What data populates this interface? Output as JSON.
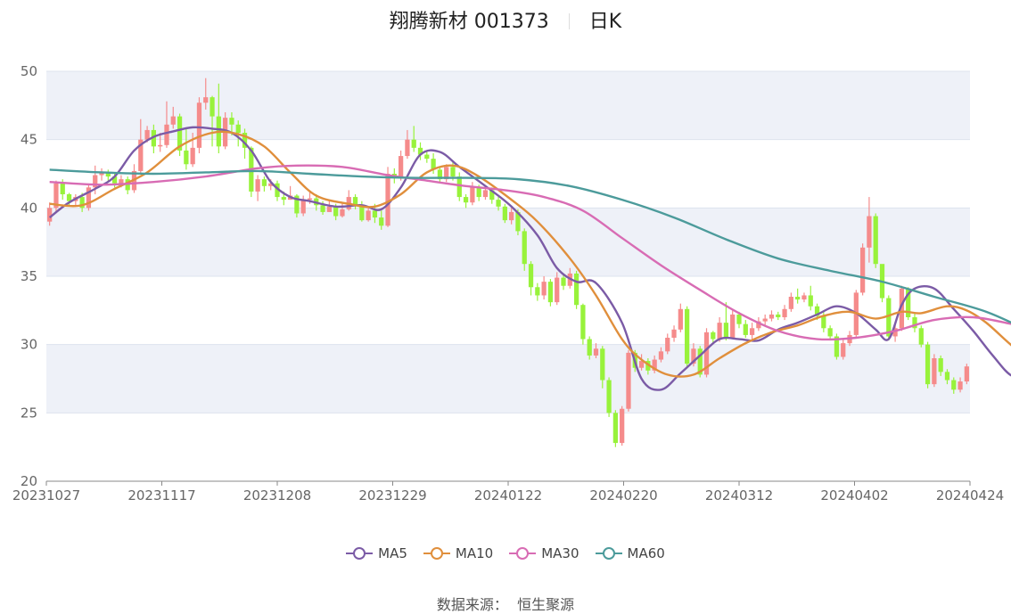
{
  "title": {
    "name": "翔腾新材 001373",
    "period": "日K"
  },
  "source": {
    "label": "数据来源：",
    "value": "恒生聚源"
  },
  "colors": {
    "up": "#f58b8b",
    "down": "#98f23b",
    "ma5": "#7b5ba6",
    "ma10": "#e08f3c",
    "ma30": "#d86cb4",
    "ma60": "#4c9b9b",
    "band": "#eef1f8",
    "grid": "#dde3ee"
  },
  "chart_data": {
    "type": "candlestick",
    "ylim": [
      20,
      50
    ],
    "yticks": [
      "20",
      "25",
      "30",
      "35",
      "40",
      "45",
      "50"
    ],
    "xticks": [
      "20231027",
      "20231117",
      "20231208",
      "20231229",
      "20240122",
      "20240220",
      "20240312",
      "20240402",
      "20240424"
    ],
    "candles": [
      [
        39.0,
        40.0,
        38.7,
        40.4
      ],
      [
        40.0,
        41.8,
        39.6,
        42.0
      ],
      [
        41.8,
        41.0,
        40.6,
        42.1
      ],
      [
        41.0,
        40.5,
        40.2,
        41.1
      ],
      [
        40.5,
        40.8,
        40.2,
        41.0
      ],
      [
        40.8,
        40.0,
        39.7,
        41.1
      ],
      [
        40.0,
        41.5,
        39.8,
        41.7
      ],
      [
        41.5,
        42.4,
        41.0,
        43.1
      ],
      [
        42.4,
        42.6,
        42.0,
        42.9
      ],
      [
        42.6,
        42.3,
        42.0,
        42.8
      ],
      [
        42.3,
        41.8,
        41.5,
        42.6
      ],
      [
        41.8,
        42.1,
        41.5,
        42.4
      ],
      [
        42.1,
        41.3,
        41.0,
        42.3
      ],
      [
        41.3,
        42.7,
        41.1,
        43.2
      ],
      [
        42.7,
        45.0,
        42.5,
        46.5
      ],
      [
        45.0,
        45.7,
        44.8,
        46.0
      ],
      [
        45.7,
        44.5,
        44.0,
        46.1
      ],
      [
        44.5,
        44.6,
        44.1,
        45.5
      ],
      [
        44.6,
        46.1,
        44.4,
        47.8
      ],
      [
        46.1,
        46.7,
        45.8,
        47.4
      ],
      [
        46.7,
        44.2,
        43.8,
        46.9
      ],
      [
        44.2,
        43.2,
        42.8,
        45.8
      ],
      [
        43.2,
        44.4,
        43.0,
        45.5
      ],
      [
        44.4,
        47.7,
        44.0,
        48.1
      ],
      [
        47.7,
        48.1,
        47.2,
        49.5
      ],
      [
        48.1,
        46.7,
        44.5,
        48.2
      ],
      [
        46.7,
        44.5,
        44.0,
        49.1
      ],
      [
        44.5,
        46.6,
        44.3,
        47.0
      ],
      [
        46.6,
        46.1,
        45.3,
        47.0
      ],
      [
        46.1,
        45.5,
        44.5,
        46.4
      ],
      [
        45.5,
        44.4,
        43.6,
        45.8
      ],
      [
        44.4,
        41.2,
        40.8,
        44.5
      ],
      [
        41.2,
        42.1,
        40.5,
        42.4
      ],
      [
        42.1,
        41.6,
        41.2,
        42.3
      ],
      [
        41.6,
        41.8,
        41.3,
        42.1
      ],
      [
        41.8,
        40.8,
        40.5,
        42.0
      ],
      [
        40.8,
        40.6,
        40.2,
        41.2
      ],
      [
        40.6,
        40.9,
        40.6,
        41.6
      ],
      [
        40.9,
        39.6,
        39.3,
        41.0
      ],
      [
        39.6,
        40.6,
        39.4,
        40.9
      ],
      [
        40.6,
        40.7,
        40.3,
        41.2
      ],
      [
        40.7,
        40.2,
        39.8,
        41.0
      ],
      [
        40.2,
        39.7,
        39.5,
        40.5
      ],
      [
        39.7,
        40.1,
        39.7,
        40.6
      ],
      [
        40.1,
        39.4,
        39.1,
        40.3
      ],
      [
        39.4,
        39.9,
        39.3,
        40.4
      ],
      [
        39.9,
        40.8,
        39.8,
        41.3
      ],
      [
        40.8,
        40.2,
        39.9,
        41.0
      ],
      [
        40.2,
        39.1,
        39.0,
        40.5
      ],
      [
        39.1,
        39.8,
        39.0,
        40.1
      ],
      [
        39.8,
        39.3,
        38.9,
        40.3
      ],
      [
        39.3,
        38.7,
        38.4,
        39.8
      ],
      [
        38.7,
        42.5,
        38.6,
        43.0
      ],
      [
        42.5,
        42.3,
        41.8,
        42.9
      ],
      [
        42.3,
        43.8,
        42.0,
        44.2
      ],
      [
        43.8,
        45.0,
        43.6,
        45.7
      ],
      [
        45.0,
        44.4,
        44.1,
        46.0
      ],
      [
        44.4,
        43.9,
        43.5,
        44.8
      ],
      [
        43.9,
        43.6,
        43.3,
        44.2
      ],
      [
        43.6,
        42.8,
        42.5,
        44.0
      ],
      [
        42.8,
        42.1,
        41.8,
        43.0
      ],
      [
        42.1,
        43.0,
        41.9,
        43.2
      ],
      [
        43.0,
        42.3,
        42.0,
        43.4
      ],
      [
        42.3,
        40.8,
        40.5,
        42.6
      ],
      [
        40.8,
        40.4,
        40.0,
        41.0
      ],
      [
        40.4,
        41.5,
        40.2,
        41.9
      ],
      [
        41.5,
        40.8,
        40.5,
        41.7
      ],
      [
        40.8,
        41.3,
        40.6,
        41.6
      ],
      [
        41.3,
        40.6,
        40.3,
        41.5
      ],
      [
        40.6,
        40.1,
        39.8,
        40.8
      ],
      [
        40.1,
        39.1,
        38.9,
        40.3
      ],
      [
        39.1,
        39.7,
        38.8,
        40.0
      ],
      [
        39.7,
        38.3,
        38.0,
        39.9
      ],
      [
        38.3,
        35.9,
        35.4,
        38.5
      ],
      [
        35.9,
        34.2,
        33.6,
        36.1
      ],
      [
        34.2,
        33.6,
        33.2,
        34.5
      ],
      [
        33.6,
        34.6,
        33.3,
        35.0
      ],
      [
        34.6,
        33.1,
        32.8,
        34.8
      ],
      [
        33.1,
        34.9,
        32.9,
        35.3
      ],
      [
        34.9,
        34.3,
        34.0,
        35.2
      ],
      [
        34.3,
        35.2,
        34.1,
        35.6
      ],
      [
        35.2,
        32.9,
        32.6,
        35.4
      ],
      [
        32.9,
        30.4,
        30.0,
        33.0
      ],
      [
        30.4,
        29.2,
        28.9,
        30.6
      ],
      [
        29.2,
        29.7,
        29.0,
        30.1
      ],
      [
        29.7,
        27.4,
        26.8,
        29.9
      ],
      [
        27.4,
        25.0,
        24.7,
        27.6
      ],
      [
        25.0,
        22.8,
        22.5,
        25.2
      ],
      [
        22.8,
        25.3,
        22.6,
        25.5
      ],
      [
        25.3,
        29.4,
        25.1,
        29.6
      ],
      [
        29.4,
        28.3,
        28.0,
        29.6
      ],
      [
        28.3,
        28.8,
        28.1,
        29.3
      ],
      [
        28.8,
        28.1,
        27.8,
        29.0
      ],
      [
        28.1,
        28.9,
        27.9,
        29.2
      ],
      [
        28.9,
        29.5,
        28.7,
        29.8
      ],
      [
        29.5,
        30.5,
        29.3,
        30.8
      ],
      [
        30.5,
        31.1,
        30.2,
        31.4
      ],
      [
        31.1,
        32.6,
        30.9,
        33.0
      ],
      [
        32.6,
        28.6,
        28.3,
        32.8
      ],
      [
        28.6,
        29.7,
        28.4,
        30.1
      ],
      [
        29.7,
        27.8,
        27.6,
        29.9
      ],
      [
        27.8,
        30.9,
        27.6,
        31.2
      ],
      [
        30.9,
        30.4,
        30.1,
        31.0
      ],
      [
        30.4,
        31.6,
        30.2,
        32.0
      ],
      [
        31.6,
        30.5,
        30.3,
        33.1
      ],
      [
        30.5,
        32.2,
        30.4,
        32.5
      ],
      [
        32.2,
        31.5,
        31.2,
        32.4
      ],
      [
        31.5,
        30.7,
        30.5,
        31.8
      ],
      [
        30.7,
        31.2,
        30.4,
        31.6
      ],
      [
        31.2,
        31.7,
        31.0,
        32.0
      ],
      [
        31.7,
        31.9,
        31.4,
        32.2
      ],
      [
        31.9,
        32.2,
        31.7,
        32.5
      ],
      [
        32.2,
        32.0,
        31.8,
        32.4
      ],
      [
        32.0,
        32.6,
        31.8,
        32.9
      ],
      [
        32.6,
        33.5,
        32.4,
        33.8
      ],
      [
        33.5,
        33.3,
        33.0,
        34.1
      ],
      [
        33.3,
        33.6,
        33.1,
        33.8
      ],
      [
        33.6,
        32.8,
        32.5,
        34.3
      ],
      [
        32.8,
        32.1,
        31.8,
        33.0
      ],
      [
        32.1,
        31.2,
        30.9,
        32.4
      ],
      [
        31.2,
        30.6,
        30.3,
        31.4
      ],
      [
        30.6,
        29.1,
        28.9,
        30.8
      ],
      [
        29.1,
        30.1,
        28.9,
        30.4
      ],
      [
        30.1,
        30.7,
        29.9,
        31.0
      ],
      [
        30.7,
        33.8,
        30.5,
        34.0
      ],
      [
        33.8,
        37.1,
        33.6,
        37.4
      ],
      [
        37.1,
        39.4,
        36.0,
        40.8
      ],
      [
        39.4,
        35.9,
        35.6,
        39.6
      ],
      [
        35.9,
        33.4,
        33.1,
        35.3
      ],
      [
        33.4,
        30.6,
        30.3,
        33.6
      ],
      [
        30.6,
        31.2,
        30.2,
        31.5
      ],
      [
        31.2,
        34.1,
        31.0,
        34.3
      ],
      [
        34.1,
        32.0,
        31.8,
        34.2
      ],
      [
        32.0,
        31.2,
        30.9,
        32.3
      ],
      [
        31.2,
        30.0,
        29.8,
        31.4
      ],
      [
        30.0,
        27.1,
        26.8,
        30.2
      ],
      [
        27.1,
        29.0,
        26.9,
        29.3
      ],
      [
        29.0,
        28.0,
        27.7,
        29.2
      ],
      [
        28.0,
        27.4,
        27.1,
        28.2
      ],
      [
        27.4,
        26.7,
        26.4,
        27.6
      ],
      [
        26.7,
        27.3,
        26.5,
        27.6
      ],
      [
        27.3,
        28.4,
        27.1,
        28.6
      ]
    ],
    "series": [
      {
        "name": "MA5",
        "points": [
          [
            0,
            39.3
          ],
          [
            3,
            40.4
          ],
          [
            7,
            41.4
          ],
          [
            10,
            42.3
          ],
          [
            13,
            44.2
          ],
          [
            16,
            45.2
          ],
          [
            19,
            45.6
          ],
          [
            22,
            45.9
          ],
          [
            25,
            45.8
          ],
          [
            28,
            45.5
          ],
          [
            31,
            44.2
          ],
          [
            34,
            41.9
          ],
          [
            37,
            40.8
          ],
          [
            40,
            40.5
          ],
          [
            44,
            40.1
          ],
          [
            48,
            40.2
          ],
          [
            51,
            39.9
          ],
          [
            54,
            41.5
          ],
          [
            57,
            43.9
          ],
          [
            60,
            44.1
          ],
          [
            63,
            43.0
          ],
          [
            67,
            41.6
          ],
          [
            71,
            40.1
          ],
          [
            75,
            38.0
          ],
          [
            78,
            35.6
          ],
          [
            81,
            34.6
          ],
          [
            84,
            34.5
          ],
          [
            88,
            31.6
          ],
          [
            91,
            27.5
          ],
          [
            94,
            26.7
          ],
          [
            97,
            27.9
          ],
          [
            100,
            29.2
          ],
          [
            103,
            30.4
          ],
          [
            106,
            30.4
          ],
          [
            109,
            30.3
          ],
          [
            112,
            31.1
          ],
          [
            115,
            31.6
          ],
          [
            118,
            32.2
          ],
          [
            121,
            32.8
          ],
          [
            124,
            32.3
          ],
          [
            127,
            31.1
          ],
          [
            129,
            30.4
          ],
          [
            131,
            32.9
          ],
          [
            133,
            34.1
          ],
          [
            136,
            34.1
          ],
          [
            139,
            32.6
          ],
          [
            142,
            31.0
          ],
          [
            145,
            29.2
          ],
          [
            148,
            27.7
          ],
          [
            151,
            27.8
          ]
        ]
      },
      {
        "name": "MA10",
        "points": [
          [
            0,
            40.3
          ],
          [
            5,
            40.2
          ],
          [
            10,
            41.4
          ],
          [
            15,
            42.6
          ],
          [
            20,
            44.5
          ],
          [
            25,
            45.5
          ],
          [
            29,
            45.4
          ],
          [
            33,
            44.5
          ],
          [
            37,
            42.6
          ],
          [
            41,
            40.9
          ],
          [
            46,
            40.3
          ],
          [
            50,
            40.1
          ],
          [
            54,
            41.0
          ],
          [
            58,
            42.6
          ],
          [
            62,
            43.1
          ],
          [
            66,
            42.3
          ],
          [
            71,
            40.6
          ],
          [
            75,
            39.0
          ],
          [
            80,
            36.3
          ],
          [
            84,
            33.6
          ],
          [
            88,
            30.4
          ],
          [
            91,
            28.9
          ],
          [
            95,
            27.8
          ],
          [
            99,
            27.8
          ],
          [
            103,
            29.0
          ],
          [
            107,
            30.1
          ],
          [
            111,
            30.9
          ],
          [
            115,
            31.4
          ],
          [
            119,
            32.1
          ],
          [
            123,
            32.4
          ],
          [
            127,
            31.9
          ],
          [
            131,
            32.4
          ],
          [
            134,
            32.3
          ],
          [
            138,
            32.8
          ],
          [
            141,
            32.5
          ],
          [
            144,
            31.6
          ],
          [
            148,
            29.9
          ],
          [
            151,
            28.9
          ]
        ]
      },
      {
        "name": "MA30",
        "points": [
          [
            0,
            41.9
          ],
          [
            8,
            41.7
          ],
          [
            16,
            41.9
          ],
          [
            24,
            42.3
          ],
          [
            32,
            42.9
          ],
          [
            38,
            43.1
          ],
          [
            45,
            43.0
          ],
          [
            52,
            42.4
          ],
          [
            58,
            42.0
          ],
          [
            64,
            41.6
          ],
          [
            70,
            41.3
          ],
          [
            76,
            40.8
          ],
          [
            82,
            39.8
          ],
          [
            88,
            37.8
          ],
          [
            94,
            35.8
          ],
          [
            100,
            34.0
          ],
          [
            106,
            32.3
          ],
          [
            112,
            31.0
          ],
          [
            118,
            30.4
          ],
          [
            124,
            30.5
          ],
          [
            130,
            31.0
          ],
          [
            136,
            31.8
          ],
          [
            142,
            32.0
          ],
          [
            148,
            31.5
          ],
          [
            151,
            31.3
          ]
        ]
      },
      {
        "name": "MA60",
        "points": [
          [
            0,
            42.8
          ],
          [
            8,
            42.6
          ],
          [
            16,
            42.5
          ],
          [
            24,
            42.6
          ],
          [
            32,
            42.7
          ],
          [
            40,
            42.5
          ],
          [
            48,
            42.3
          ],
          [
            56,
            42.2
          ],
          [
            64,
            42.2
          ],
          [
            72,
            42.1
          ],
          [
            80,
            41.6
          ],
          [
            88,
            40.6
          ],
          [
            96,
            39.3
          ],
          [
            104,
            37.7
          ],
          [
            112,
            36.3
          ],
          [
            120,
            35.4
          ],
          [
            128,
            34.6
          ],
          [
            136,
            33.5
          ],
          [
            144,
            32.4
          ],
          [
            151,
            30.9
          ]
        ]
      }
    ]
  }
}
